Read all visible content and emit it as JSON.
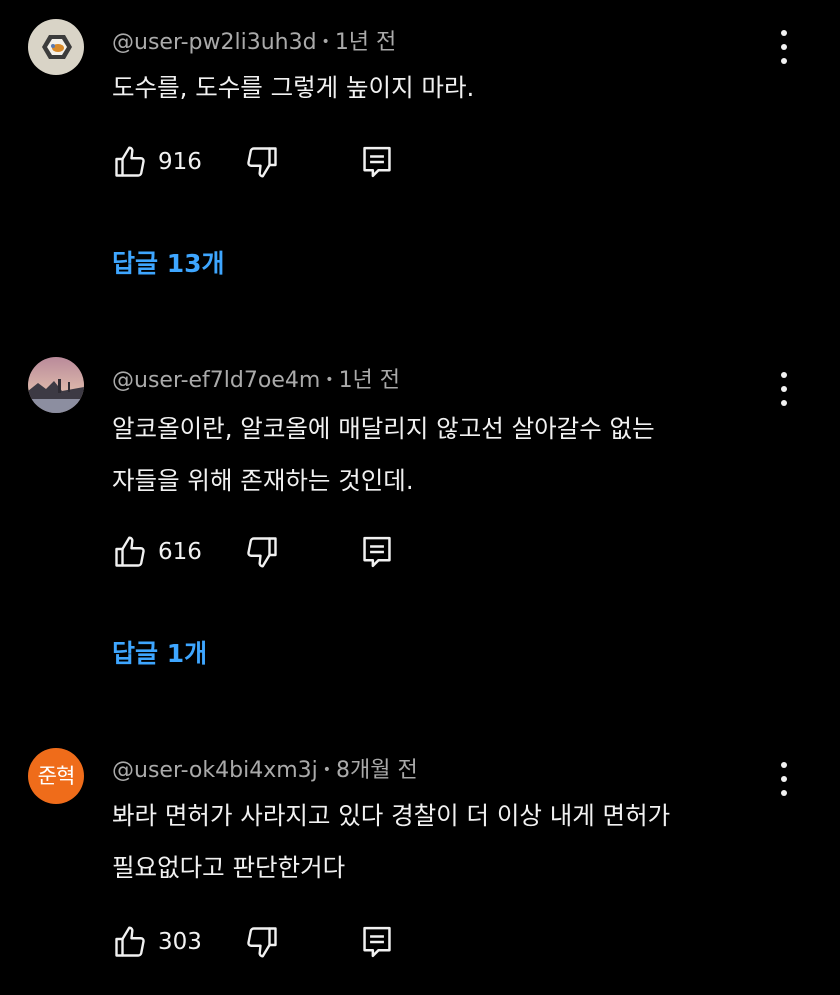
{
  "comments": [
    {
      "author": "@user-pw2li3uh3d",
      "time": "1년 전",
      "separator": "•",
      "lines": [
        "도수를, 도수를 그렇게 높이지 마라."
      ],
      "likes": "916",
      "replies_label": "답글 13개",
      "avatar_icon": "hexagon-toy-avatar"
    },
    {
      "author": "@user-ef7ld7oe4m",
      "time": "1년 전",
      "separator": "•",
      "lines": [
        "알코올이란, 알코올에 매달리지 않고선 살아갈수 없는",
        "자들을 위해 존재하는 것인데."
      ],
      "likes": "616",
      "replies_label": "답글 1개",
      "avatar_icon": "sunset-landscape-avatar"
    },
    {
      "author": "@user-ok4bi4xm3j",
      "time": "8개월 전",
      "separator": "•",
      "lines": [
        "봐라 면허가 사라지고 있다 경찰이 더 이상 내게 면허가",
        "필요없다고 판단한거다"
      ],
      "likes": "303",
      "avatar_initial": "준혁",
      "avatar_color": "#ef6c1a"
    }
  ],
  "colors": {
    "background": "#000000",
    "text": "#f1f1f1",
    "meta": "#aaaaaa",
    "link": "#3ea6ff"
  },
  "icons": {
    "like": "thumbs-up-icon",
    "dislike": "thumbs-down-icon",
    "reply": "reply-comment-icon",
    "more": "more-vertical-icon"
  }
}
